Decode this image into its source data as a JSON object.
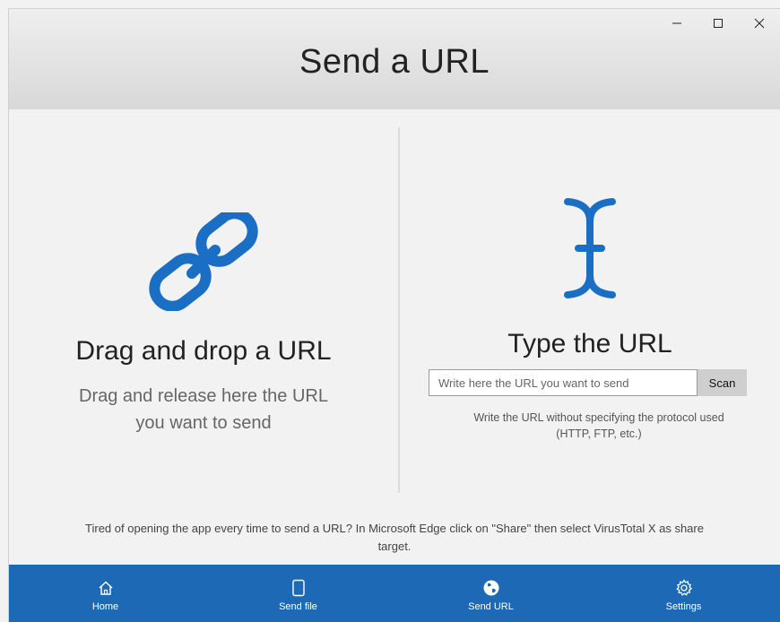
{
  "window": {
    "title": "Send a URL",
    "controls": {
      "minimize": "–",
      "maximize": "☐",
      "close": "✕"
    }
  },
  "left": {
    "icon": "link-icon",
    "title": "Drag and drop a URL",
    "subtitle_line1": "Drag and release here the URL",
    "subtitle_line2": "you want to send"
  },
  "right": {
    "icon": "text-cursor-icon",
    "title": "Type the URL",
    "input_placeholder": "Write here the URL you want to send",
    "input_value": "",
    "scan_label": "Scan",
    "hint_line1": "Write the URL without specifying the protocol used",
    "hint_line2": "(HTTP, FTP, etc.)"
  },
  "footer": {
    "note_line1": "Tired of opening the app every time to send a URL? In Microsoft Edge click on \"Share\" then select VirusTotal X as share",
    "note_line2": "target."
  },
  "nav": {
    "items": [
      {
        "label": "Home",
        "icon": "home-icon"
      },
      {
        "label": "Send file",
        "icon": "file-icon"
      },
      {
        "label": "Send URL",
        "icon": "globe-icon"
      },
      {
        "label": "Settings",
        "icon": "gear-icon"
      }
    ]
  },
  "colors": {
    "accent": "#1e69b5",
    "icon_blue": "#1a6fc4",
    "titlebar": "#dcdcdc"
  }
}
